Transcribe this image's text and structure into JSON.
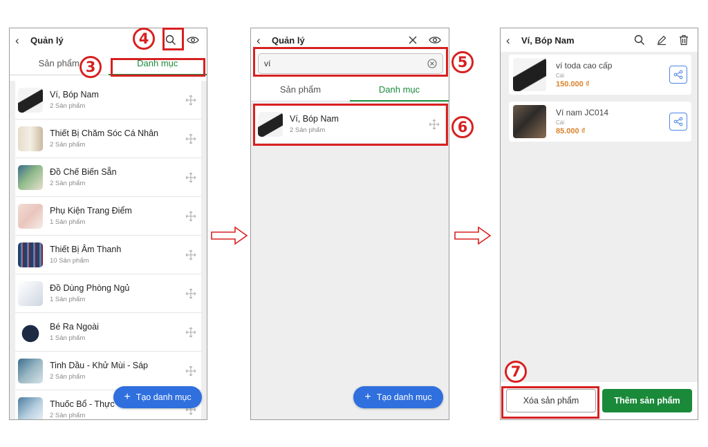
{
  "screen1": {
    "header": {
      "back_icon": "chevron-left-icon",
      "title": "Quản lý",
      "icons": [
        "search-icon",
        "eye-icon"
      ]
    },
    "tabs": [
      "Sản phẩm",
      "Danh mục"
    ],
    "active_tab": "Danh mục",
    "categories": [
      {
        "name": "Ví, Bóp Nam",
        "count": "2 Sản phẩm"
      },
      {
        "name": "Thiết Bị Chăm Sóc Cá Nhân",
        "count": "2 Sản phẩm"
      },
      {
        "name": "Đồ Chế Biến Sẵn",
        "count": "2 Sản phẩm"
      },
      {
        "name": "Phụ Kiện Trang Điểm",
        "count": "1 Sản phẩm"
      },
      {
        "name": "Thiết Bị Âm Thanh",
        "count": "10 Sản phẩm"
      },
      {
        "name": "Đồ Dùng Phòng Ngủ",
        "count": "1 Sản phẩm"
      },
      {
        "name": "Bé Ra Ngoài",
        "count": "1 Sản phẩm"
      },
      {
        "name": "Tinh Dầu - Khử Mùi - Sáp",
        "count": "2 Sản phẩm"
      },
      {
        "name": "Thuốc Bổ - Thực",
        "count": "2 Sản phẩm"
      }
    ],
    "fab_label": "Tạo danh mục"
  },
  "screen2": {
    "header": {
      "title": "Quản lý",
      "icons": [
        "close-icon",
        "eye-icon"
      ]
    },
    "search": {
      "value": "ví",
      "clear_icon": "clear-circle-icon"
    },
    "tabs": [
      "Sản phẩm",
      "Danh mục"
    ],
    "active_tab": "Danh mục",
    "result": {
      "name": "Ví, Bóp Nam",
      "count": "2 Sản phẩm"
    },
    "fab_label": "Tạo danh mục"
  },
  "screen3": {
    "header": {
      "title": "Ví, Bóp Nam",
      "icons": [
        "search-icon",
        "edit-icon",
        "trash-icon"
      ]
    },
    "products": [
      {
        "name": "ví toda cao cấp",
        "unit": "Cái",
        "price": "150.000 ₫"
      },
      {
        "name": "Ví nam JC014",
        "unit": "Cái",
        "price": "85.000 ₫"
      }
    ],
    "delete_button": "Xóa sản phẩm",
    "add_button": "Thêm sản phẩm"
  },
  "steps": [
    "3",
    "4",
    "5",
    "6",
    "7"
  ],
  "colors": {
    "accent_green": "#1a8a3a",
    "fab_blue": "#2f6fde",
    "highlight_red": "#d82020",
    "price_orange": "#d9822b"
  }
}
